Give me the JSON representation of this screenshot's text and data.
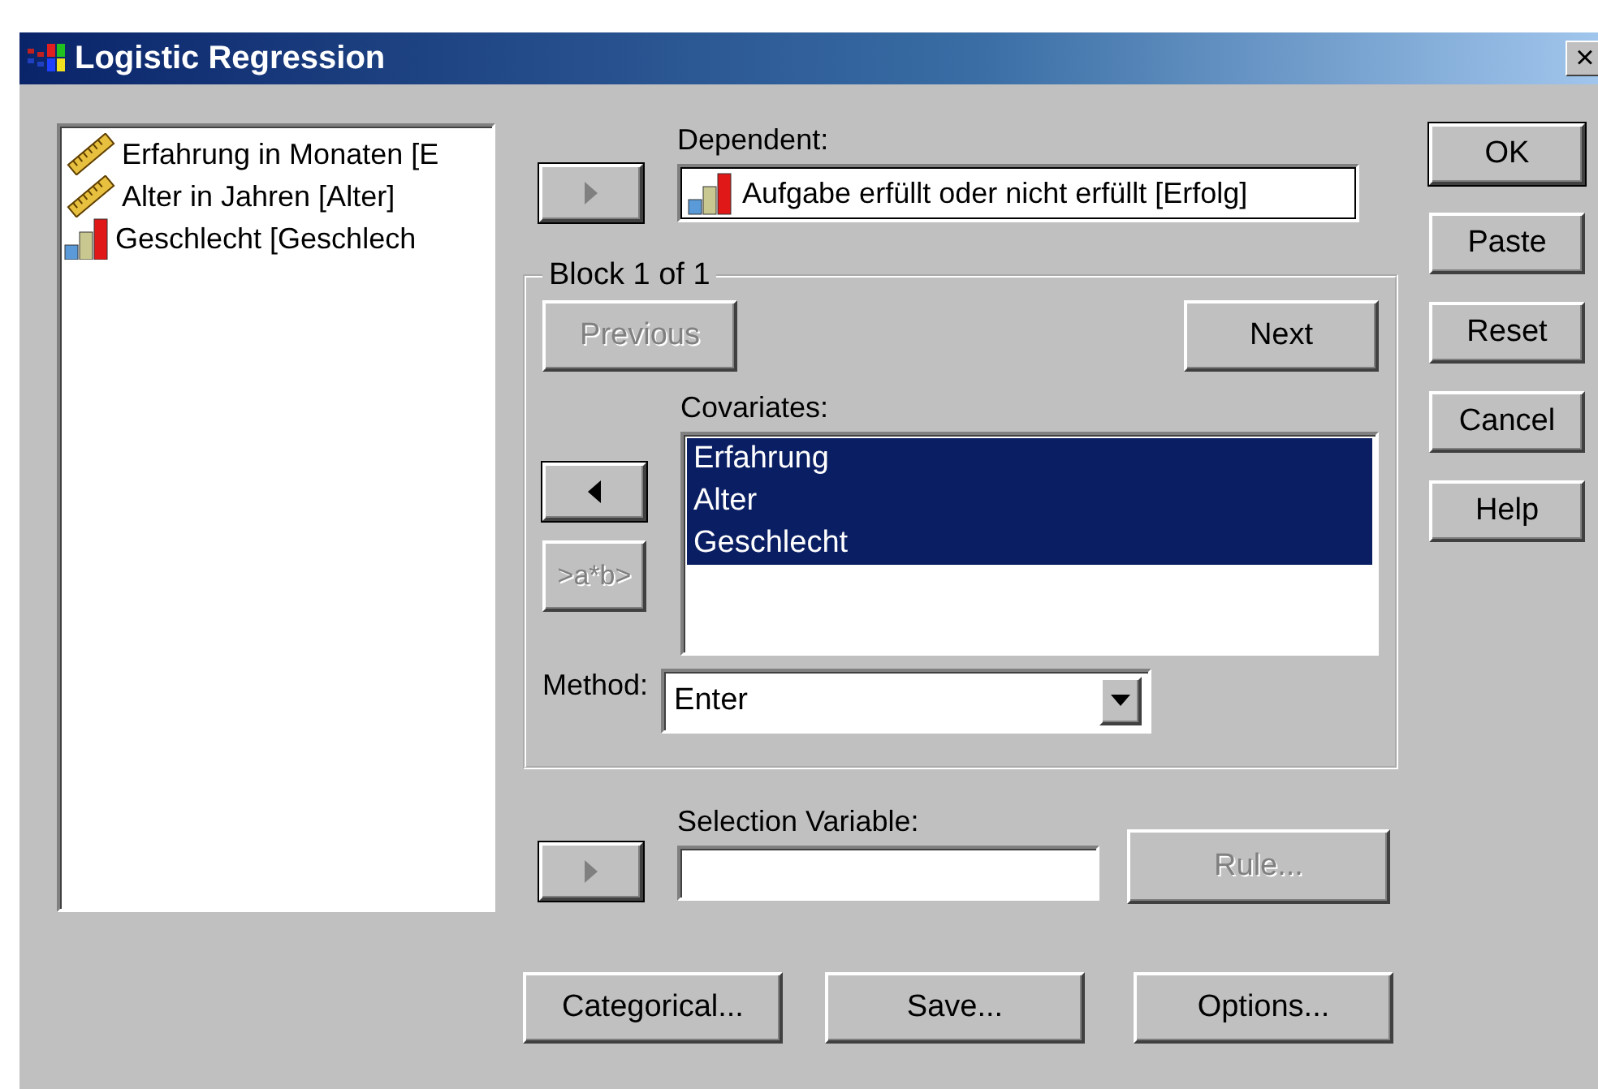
{
  "window": {
    "title": "Logistic Regression",
    "close": "×"
  },
  "source_variables": [
    {
      "name": "Erfahrung in Monaten [E",
      "kind": "scale"
    },
    {
      "name": "Alter in Jahren [Alter]",
      "kind": "scale"
    },
    {
      "name": "Geschlecht [Geschlech",
      "kind": "nominal"
    }
  ],
  "dependent": {
    "label": "Dependent:",
    "arrow_disabled": true,
    "value": "Aufgabe erfüllt oder nicht erfüllt [Erfolg]",
    "kind": "nominal"
  },
  "block": {
    "title": "Block 1 of 1",
    "previous": {
      "label": "Previous",
      "disabled": true
    },
    "next": {
      "label": "Next",
      "disabled": false
    },
    "covariates_label": "Covariates:",
    "arrow_disabled": false,
    "interaction": {
      "label": ">a*b>",
      "disabled": true
    },
    "covariates": [
      {
        "text": "Erfahrung",
        "selected": true
      },
      {
        "text": "Alter",
        "selected": true
      },
      {
        "text": "Geschlecht",
        "selected": true
      }
    ],
    "method_label": "Method:",
    "method": "Enter"
  },
  "selection": {
    "label": "Selection Variable:",
    "arrow_disabled": true,
    "rule": {
      "label": "Rule...",
      "disabled": true
    }
  },
  "side_buttons": [
    "OK",
    "Paste",
    "Reset",
    "Cancel",
    "Help"
  ],
  "bottom_buttons": [
    "Categorical...",
    "Save...",
    "Options..."
  ]
}
